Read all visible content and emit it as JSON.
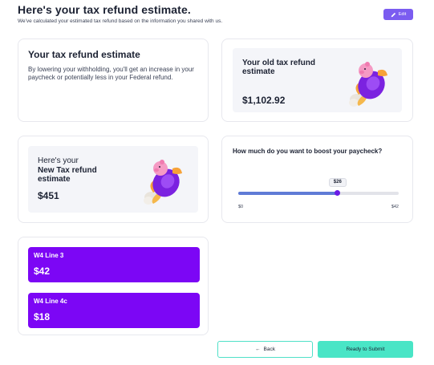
{
  "header": {
    "title": "Here's your tax refund estimate.",
    "subtitle": "We've calculated your estimated tax refund based on the information you shared with us.",
    "edit_label": "Edit"
  },
  "estimate_card": {
    "title": "Your tax refund estimate",
    "description": "By lowering your withholding, you'll get an increase in your paycheck or potentially less in your Federal refund."
  },
  "old_card": {
    "title": "Your old tax refund estimate",
    "amount": "$1,102.92"
  },
  "new_card": {
    "pre": "Here's your",
    "title": "New Tax refund estimate",
    "amount": "$451"
  },
  "boost": {
    "question": "How much do you want to boost your paycheck?",
    "value_label": "$26",
    "value": 26,
    "min": 0,
    "max": 42,
    "min_label": "$0",
    "max_label": "$42"
  },
  "w4": {
    "line3_label": "W4 Line 3",
    "line3_value": "$42",
    "line4c_label": "W4 Line 4c",
    "line4c_value": "$18"
  },
  "footer": {
    "back_label": "Back",
    "submit_label": "Ready to Submit"
  },
  "colors": {
    "accent_purple": "#7c06f5",
    "edit_button": "#7b5cf0",
    "slider_fill": "#5f7bd6",
    "teal": "#49e5c6"
  },
  "icons": {
    "edit": "pencil-icon",
    "back": "arrow-left-icon",
    "illustration": "piggy-bank-rocket-icon"
  }
}
